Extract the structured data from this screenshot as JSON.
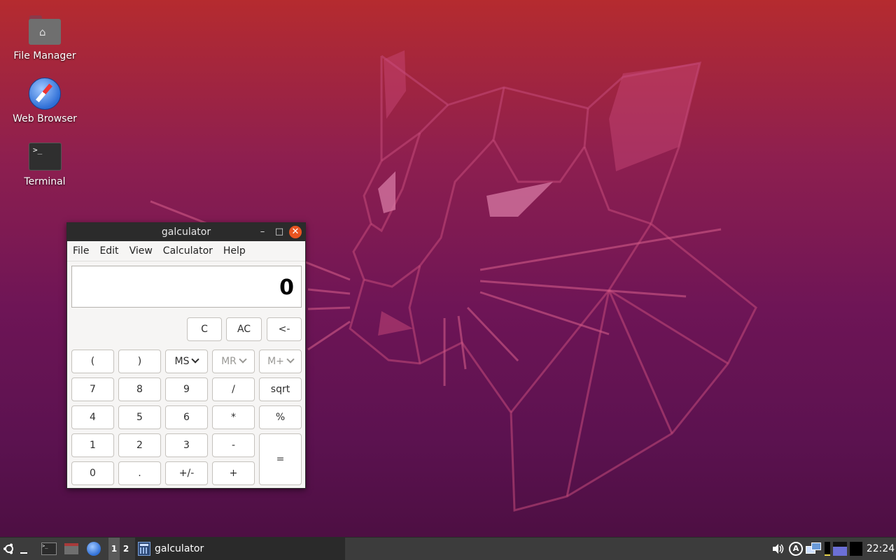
{
  "desktop": {
    "icons": [
      {
        "label": "File Manager",
        "icon": "home-folder-icon"
      },
      {
        "label": "Web Browser",
        "icon": "compass-icon"
      },
      {
        "label": "Terminal",
        "icon": "terminal-icon"
      }
    ]
  },
  "window": {
    "title": "galculator",
    "controls": {
      "minimize": "–",
      "maximize": "□",
      "close": "✕"
    },
    "menu": [
      "File",
      "Edit",
      "View",
      "Calculator",
      "Help"
    ],
    "display_value": "0",
    "buttons": {
      "top": [
        "C",
        "AC",
        "<-"
      ],
      "memory": [
        {
          "label": "MS",
          "enabled": true
        },
        {
          "label": "MR",
          "enabled": false
        },
        {
          "label": "M+",
          "enabled": false
        }
      ],
      "paren_open": "(",
      "paren_close": ")",
      "row1": [
        "7",
        "8",
        "9",
        "/",
        "sqrt"
      ],
      "row2": [
        "4",
        "5",
        "6",
        "*",
        "%"
      ],
      "row3": [
        "1",
        "2",
        "3",
        "-"
      ],
      "row4": [
        "0",
        ".",
        "+/-",
        "+"
      ],
      "equals": "="
    }
  },
  "taskbar": {
    "workspaces": [
      "1",
      "2"
    ],
    "active_task": "galculator",
    "clock": "22:24"
  },
  "colors": {
    "accent_close": "#e95420",
    "panel": "#3c3c3c"
  }
}
